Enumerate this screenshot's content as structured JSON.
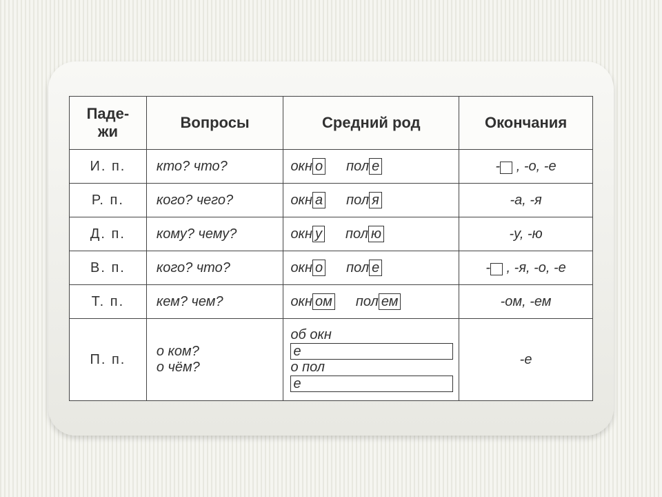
{
  "headers": {
    "col1": "Паде-\nжи",
    "col2": "Вопросы",
    "col3": "Средний  род",
    "col4": "Окончания"
  },
  "rows": [
    {
      "case": "И.  п.",
      "question": "кто? что?",
      "ex1_stem": "окн",
      "ex1_end": "о",
      "ex2_stem": "пол",
      "ex2_end": "е",
      "endings_before": "-",
      "endings_box": true,
      "endings_after": " , -о, -е"
    },
    {
      "case": "Р.  п.",
      "question": "кого? чего?",
      "ex1_stem": "окн",
      "ex1_end": "а",
      "ex2_stem": "пол",
      "ex2_end": "я",
      "endings_plain": "-а, -я"
    },
    {
      "case": "Д.  п.",
      "question": "кому? чему?",
      "ex1_stem": "окн",
      "ex1_end": "у",
      "ex2_stem": "пол",
      "ex2_end": "ю",
      "endings_plain": "-у, -ю"
    },
    {
      "case": "В.  п.",
      "question": "кого? что?",
      "ex1_stem": "окн",
      "ex1_end": "о",
      "ex2_stem": "пол",
      "ex2_end": "е",
      "endings_before": "-",
      "endings_box": true,
      "endings_after": " , -я, -о, -е"
    },
    {
      "case": "Т.  п.",
      "question": "кем? чем?",
      "ex1_stem": "окн",
      "ex1_end": "ом",
      "ex2_stem": "пол",
      "ex2_end": "ем",
      "endings_plain": "-ом, -ем"
    },
    {
      "case": "П.  п.",
      "question_l1": "о ком?",
      "question_l2": "о чём?",
      "ex1_pre": "об ",
      "ex1_stem": "окн",
      "ex1_end": "е",
      "ex2_pre": "о ",
      "ex2_stem": "пол",
      "ex2_end": "е",
      "endings_plain": "-е",
      "two_line": true
    }
  ]
}
